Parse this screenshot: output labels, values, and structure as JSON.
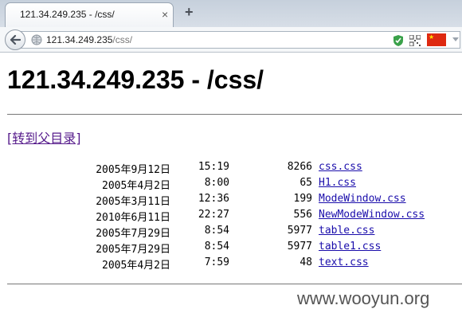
{
  "browser": {
    "tab_title": "121.34.249.235 - /css/",
    "close_glyph": "×",
    "new_tab_glyph": "+",
    "url_host": "121.34.249.235",
    "url_path": "/css/"
  },
  "page": {
    "title": "121.34.249.235 - /css/",
    "parent_link": "[转到父目录]",
    "files": [
      {
        "date": "2005年9月12日",
        "time": "15:19",
        "size": "8266",
        "name": "css.css"
      },
      {
        "date": "2005年4月2日",
        "time": "8:00",
        "size": "65",
        "name": "H1.css"
      },
      {
        "date": "2005年3月11日",
        "time": "12:36",
        "size": "199",
        "name": "ModeWindow.css"
      },
      {
        "date": "2010年6月11日",
        "time": "22:27",
        "size": "556",
        "name": "NewModeWindow.css"
      },
      {
        "date": "2005年7月29日",
        "time": "8:54",
        "size": "5977",
        "name": "table.css"
      },
      {
        "date": "2005年7月29日",
        "time": "8:54",
        "size": "5977",
        "name": "table1.css"
      },
      {
        "date": "2005年4月2日",
        "time": "7:59",
        "size": "48",
        "name": "text.css"
      }
    ]
  },
  "watermark": "www.wooyun.org",
  "colors": {
    "link": "#1a0dab",
    "visited_link": "#551a8b",
    "flag_red": "#de2910",
    "shield_green": "#3aa14a"
  }
}
